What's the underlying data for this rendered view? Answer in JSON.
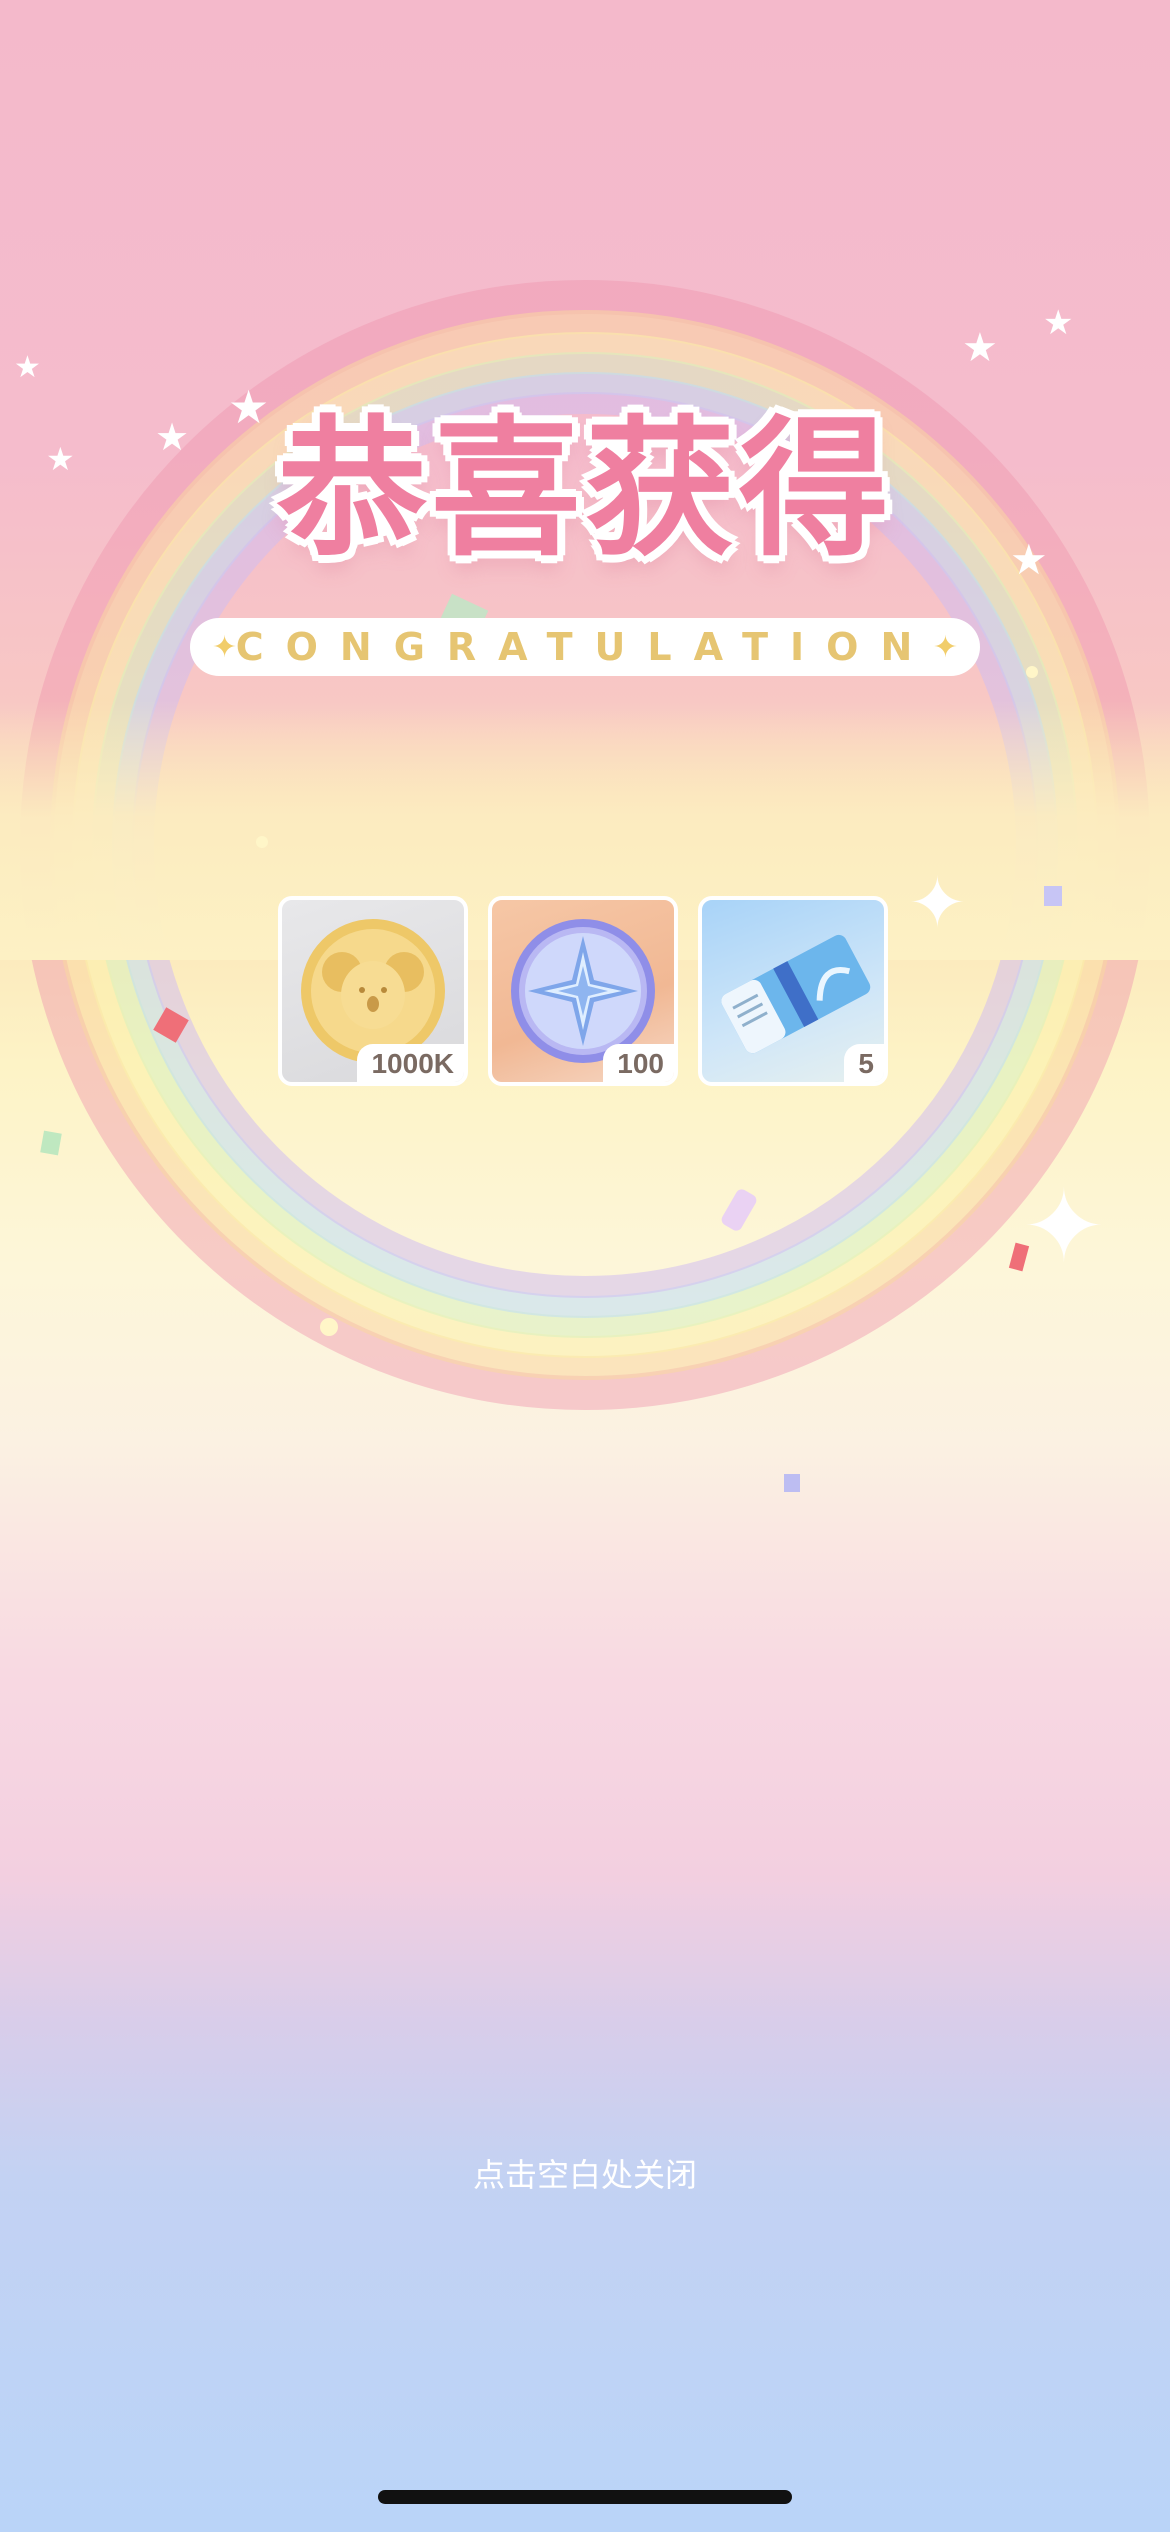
{
  "title": {
    "cn": "恭喜获得",
    "en": "CONGRATULATION"
  },
  "rewards": [
    {
      "icon": "koala-coin-icon",
      "quantity": "1000K"
    },
    {
      "icon": "star-compass-medal-icon",
      "quantity": "100"
    },
    {
      "icon": "ticket-icon",
      "quantity": "5"
    }
  ],
  "close_hint": "点击空白处关闭",
  "colors": {
    "title_pink": "#ef7fa0",
    "accent_gold": "#e6c572"
  }
}
